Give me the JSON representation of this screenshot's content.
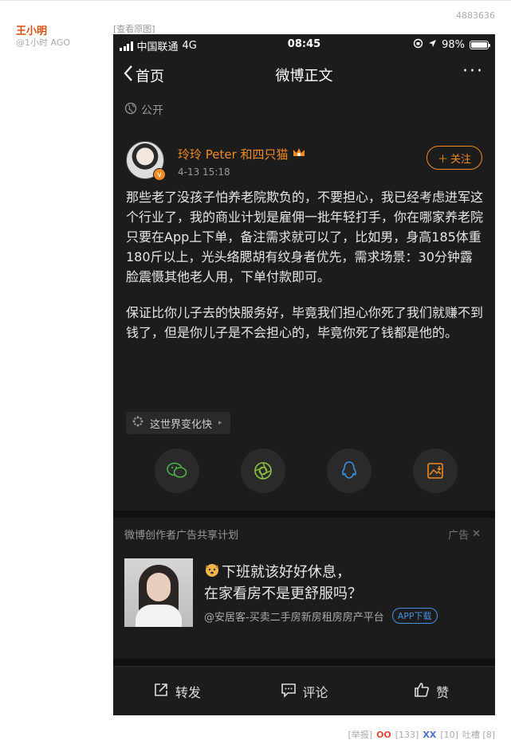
{
  "post": {
    "id": "4883636",
    "author": "王小明",
    "time": "@1小时 AGO",
    "view_original": "查看原图"
  },
  "phone": {
    "status": {
      "carrier": "中国联通",
      "network": "4G",
      "time": "08:45",
      "battery": "98%",
      "battery_level": 0.98
    },
    "nav": {
      "back_label": "首页",
      "title": "微博正文",
      "more": "···"
    },
    "visibility": "公开",
    "poster": {
      "name": "玲玲 Peter 和四只猫",
      "time": "4-13 15:18",
      "follow_label": "关注"
    },
    "body": [
      "那些老了没孩子怕养老院欺负的，不要担心，我已经考虑进军这个行业了，我的商业计划是雇佣一批年轻打手，你在哪家养老院只要在App上下单，备注需求就可以了，比如男，身高185体重180斤以上，光头络腮胡有纹身者优先，需求场景：30分钟露脸震慑其他老人用，下单付款即可。",
      "保证比你儿子去的快服务好，毕竟我们担心你死了我们就赚不到钱了，但是你儿子是不会担心的，毕竟你死了钱都是他的。"
    ],
    "topic": "这世界变化快",
    "share_icons": [
      "wechat-icon",
      "moments-icon",
      "qq-icon",
      "save-image-icon"
    ],
    "ad": {
      "plan_label": "微博创作者广告共享计划",
      "ad_label": "广告",
      "headline_1": "下班就该好好休息，",
      "headline_2": "在家看房不是更舒服吗？",
      "source": "@安居客-买卖二手房新房租房房产平台",
      "download_label": "APP下载"
    },
    "actions": {
      "repost": "转发",
      "comment": "评论",
      "like": "赞"
    }
  },
  "footer": {
    "report": "[举报]",
    "oo_label": "OO",
    "oo_count": "[133]",
    "xx_label": "XX",
    "xx_count": "[10]",
    "tucao": "吐槽 [8]"
  },
  "colors": {
    "accent": "#f08a24",
    "dark_bg": "#1c1c1c",
    "author": "#d4500f",
    "link_blue": "#4a8fe0"
  }
}
